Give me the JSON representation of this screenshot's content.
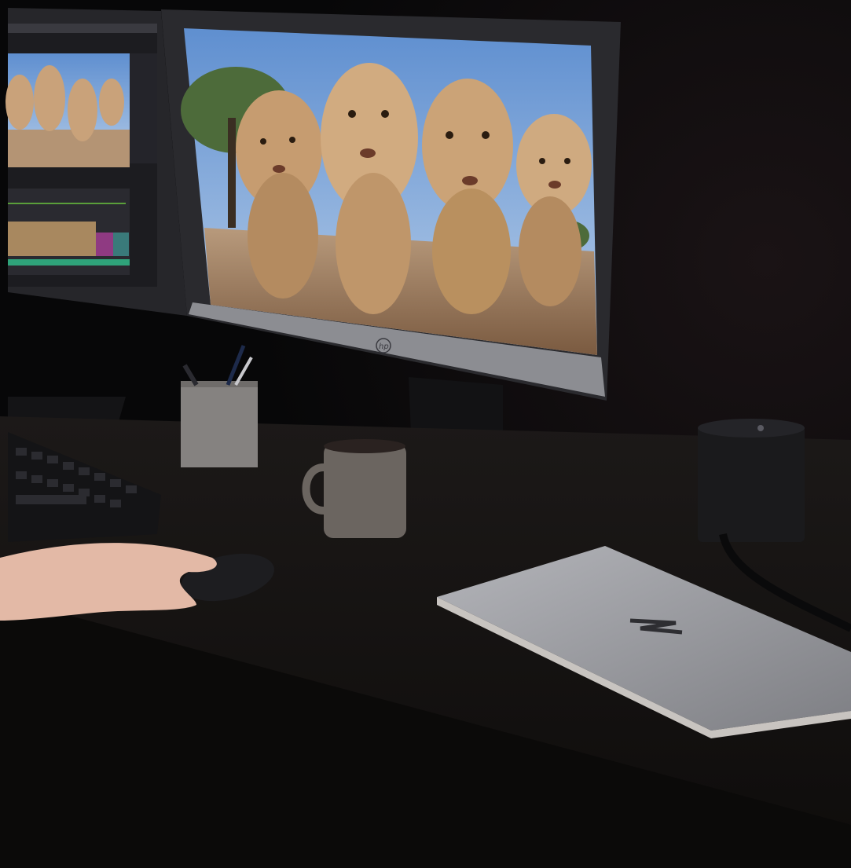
{
  "scene": {
    "logos": {
      "monitor_logo": "hp",
      "laptop_logo": "Z"
    },
    "icons": [
      "hp-logo-icon",
      "z-logo-icon"
    ],
    "colors": {
      "background": "#070708",
      "desk": "#1a1716",
      "monitor_bezel": "#2a2a2e",
      "monitor_stand_silver": "#8c8d92",
      "sky": "#7aa3d6",
      "ground": "#a9876a",
      "lion_fur": "#c9a27a",
      "laptop_silver": "#9a9ba0",
      "mug": "#6b6560",
      "pen_holder": "#858280",
      "keyboard": "#141416",
      "mouse": "#1d1d20",
      "dock": "#1a1a1c",
      "skin": "#e3b9a6"
    }
  }
}
